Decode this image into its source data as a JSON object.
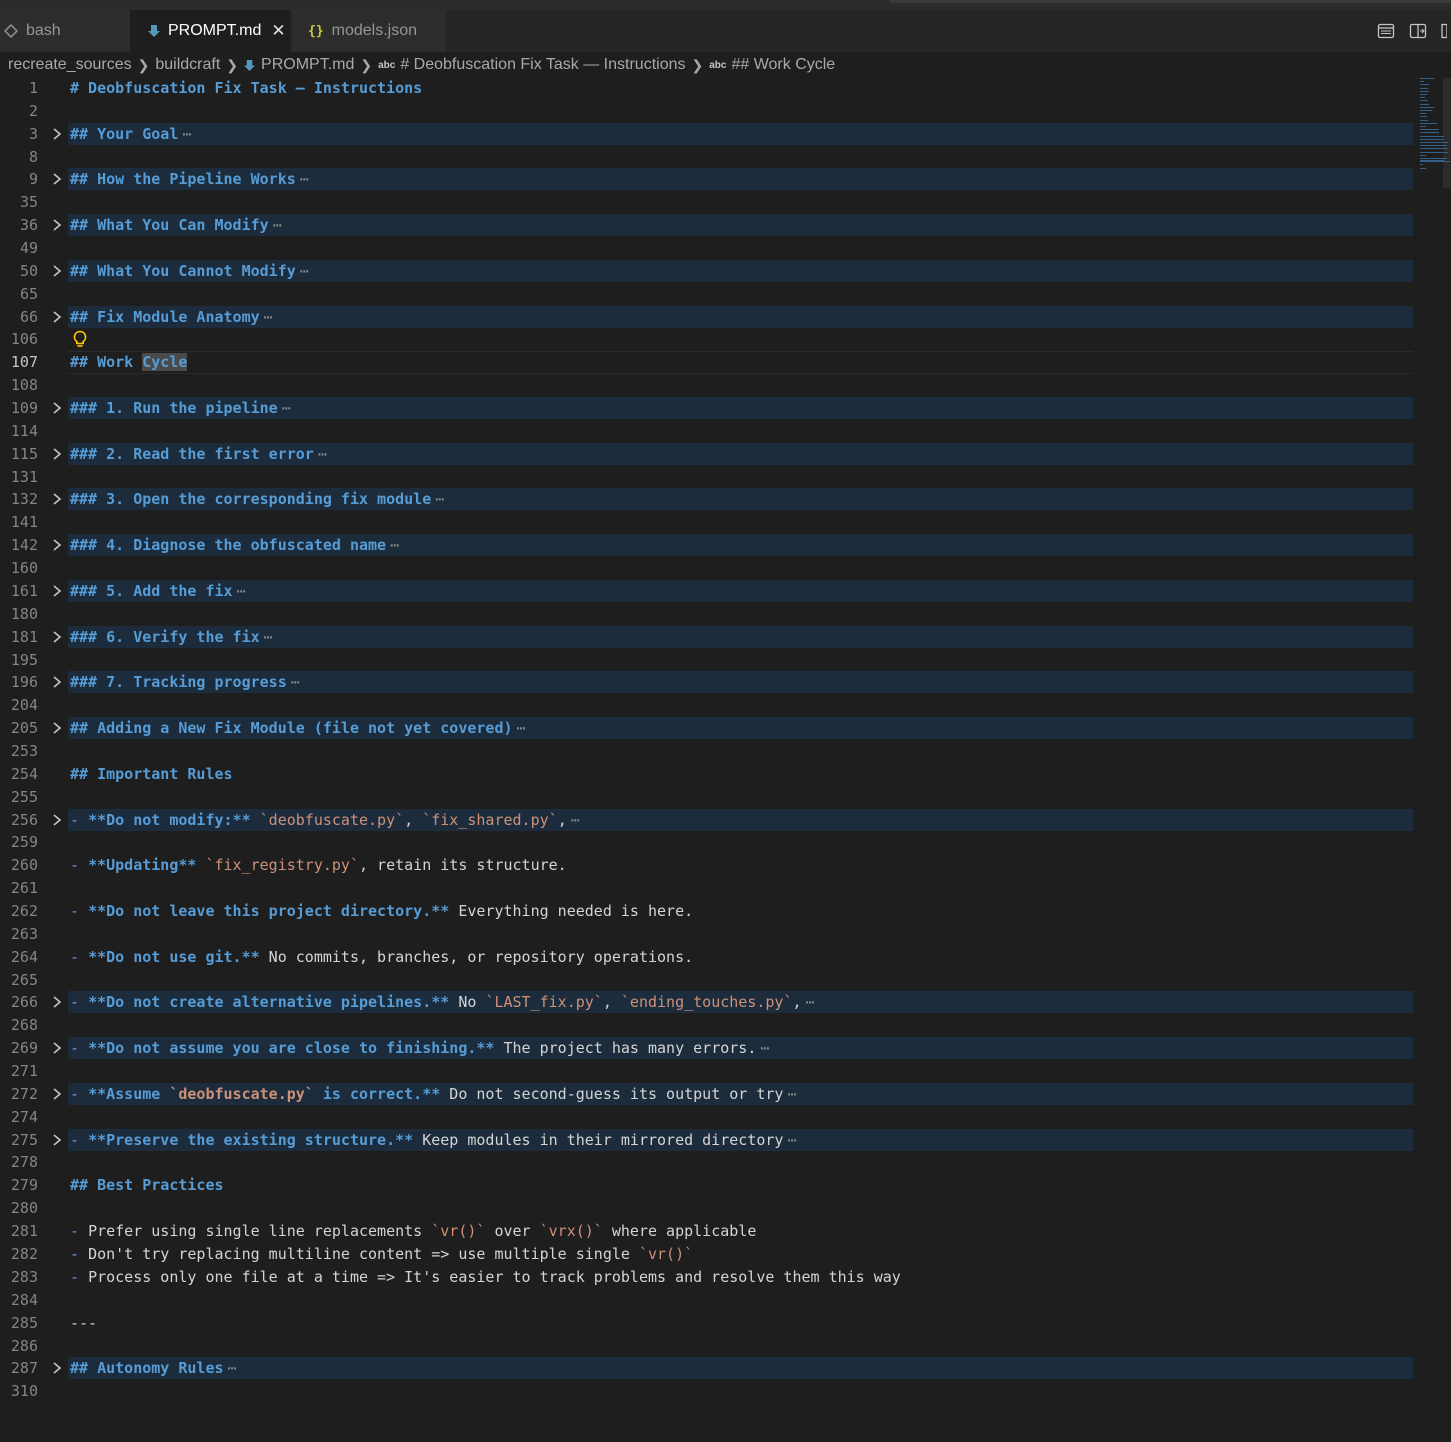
{
  "tabs": [
    {
      "label": "bash",
      "icon": "terminal-icon",
      "active": false
    },
    {
      "label": "PROMPT.md",
      "icon": "markdown-icon",
      "active": true
    },
    {
      "label": "models.json",
      "icon": "json-braces-icon",
      "active": false
    }
  ],
  "breadcrumb": {
    "folder1": "recreate_sources",
    "folder2": "buildcraft",
    "file": "PROMPT.md",
    "abc_badge": "abc",
    "section1": "# Deobfuscation Fix Task — Instructions",
    "section2": "## Work Cycle"
  },
  "editor": {
    "lines": [
      {
        "n": "1",
        "fold": false,
        "band": false,
        "segs": [
          {
            "t": "h",
            "v": "# Deobfuscation Fix Task — Instructions"
          }
        ]
      },
      {
        "n": "2",
        "segs": []
      },
      {
        "n": "3",
        "fold": true,
        "band": true,
        "segs": [
          {
            "t": "h",
            "v": "## Your Goal"
          }
        ]
      },
      {
        "n": "8",
        "segs": []
      },
      {
        "n": "9",
        "fold": true,
        "band": true,
        "segs": [
          {
            "t": "h",
            "v": "## How the Pipeline Works"
          }
        ]
      },
      {
        "n": "35",
        "segs": []
      },
      {
        "n": "36",
        "fold": true,
        "band": true,
        "segs": [
          {
            "t": "h",
            "v": "## What You Can Modify"
          }
        ]
      },
      {
        "n": "49",
        "segs": []
      },
      {
        "n": "50",
        "fold": true,
        "band": true,
        "segs": [
          {
            "t": "h",
            "v": "## What You Cannot Modify"
          }
        ]
      },
      {
        "n": "65",
        "segs": []
      },
      {
        "n": "66",
        "fold": true,
        "band": true,
        "segs": [
          {
            "t": "h",
            "v": "## Fix Module Anatomy"
          }
        ]
      },
      {
        "n": "106",
        "bulb": true,
        "segs": []
      },
      {
        "n": "107",
        "current": true,
        "segs": [
          {
            "t": "h",
            "v": "## Work "
          },
          {
            "t": "hhl",
            "v": "Cycle"
          }
        ]
      },
      {
        "n": "108",
        "segs": []
      },
      {
        "n": "109",
        "fold": true,
        "band": true,
        "segs": [
          {
            "t": "h",
            "v": "### 1. Run the pipeline"
          }
        ]
      },
      {
        "n": "114",
        "segs": []
      },
      {
        "n": "115",
        "fold": true,
        "band": true,
        "segs": [
          {
            "t": "h",
            "v": "### 2. Read the first error"
          }
        ]
      },
      {
        "n": "131",
        "segs": []
      },
      {
        "n": "132",
        "fold": true,
        "band": true,
        "segs": [
          {
            "t": "h",
            "v": "### 3. Open the corresponding fix module"
          }
        ]
      },
      {
        "n": "141",
        "segs": []
      },
      {
        "n": "142",
        "fold": true,
        "band": true,
        "segs": [
          {
            "t": "h",
            "v": "### 4. Diagnose the obfuscated name"
          }
        ]
      },
      {
        "n": "160",
        "segs": []
      },
      {
        "n": "161",
        "fold": true,
        "band": true,
        "segs": [
          {
            "t": "h",
            "v": "### 5. Add the fix"
          }
        ]
      },
      {
        "n": "180",
        "segs": []
      },
      {
        "n": "181",
        "fold": true,
        "band": true,
        "segs": [
          {
            "t": "h",
            "v": "### 6. Verify the fix"
          }
        ]
      },
      {
        "n": "195",
        "segs": []
      },
      {
        "n": "196",
        "fold": true,
        "band": true,
        "segs": [
          {
            "t": "h",
            "v": "### 7. Tracking progress"
          }
        ]
      },
      {
        "n": "204",
        "segs": []
      },
      {
        "n": "205",
        "fold": true,
        "band": true,
        "segs": [
          {
            "t": "h",
            "v": "## Adding a New Fix Module (file not yet covered)"
          }
        ]
      },
      {
        "n": "253",
        "segs": []
      },
      {
        "n": "254",
        "segs": [
          {
            "t": "h",
            "v": "## Important Rules"
          }
        ]
      },
      {
        "n": "255",
        "segs": []
      },
      {
        "n": "256",
        "fold": true,
        "band": true,
        "segs": [
          {
            "t": "dash",
            "v": "- "
          },
          {
            "t": "b",
            "v": "**Do not modify:**"
          },
          {
            "t": "p",
            "v": " "
          },
          {
            "t": "c",
            "v": "`deobfuscate.py`"
          },
          {
            "t": "p",
            "v": ", "
          },
          {
            "t": "c",
            "v": "`fix_shared.py`"
          },
          {
            "t": "p",
            "v": ","
          }
        ]
      },
      {
        "n": "259",
        "segs": []
      },
      {
        "n": "260",
        "segs": [
          {
            "t": "dash",
            "v": "- "
          },
          {
            "t": "b",
            "v": "**Updating**"
          },
          {
            "t": "p",
            "v": " "
          },
          {
            "t": "c",
            "v": "`fix_registry.py`"
          },
          {
            "t": "p",
            "v": ", retain its structure."
          }
        ]
      },
      {
        "n": "261",
        "segs": []
      },
      {
        "n": "262",
        "segs": [
          {
            "t": "dash",
            "v": "- "
          },
          {
            "t": "b",
            "v": "**Do not leave this project directory.**"
          },
          {
            "t": "p",
            "v": " Everything needed is here."
          }
        ]
      },
      {
        "n": "263",
        "segs": []
      },
      {
        "n": "264",
        "segs": [
          {
            "t": "dash",
            "v": "- "
          },
          {
            "t": "b",
            "v": "**Do not use git.**"
          },
          {
            "t": "p",
            "v": " No commits, branches, or repository operations."
          }
        ]
      },
      {
        "n": "265",
        "segs": []
      },
      {
        "n": "266",
        "fold": true,
        "band": true,
        "segs": [
          {
            "t": "dash",
            "v": "- "
          },
          {
            "t": "b",
            "v": "**Do not create alternative pipelines.**"
          },
          {
            "t": "p",
            "v": " No "
          },
          {
            "t": "c",
            "v": "`LAST_fix.py`"
          },
          {
            "t": "p",
            "v": ", "
          },
          {
            "t": "c",
            "v": "`ending_touches.py`"
          },
          {
            "t": "p",
            "v": ","
          }
        ]
      },
      {
        "n": "268",
        "segs": []
      },
      {
        "n": "269",
        "fold": true,
        "band": true,
        "segs": [
          {
            "t": "dash",
            "v": "- "
          },
          {
            "t": "b",
            "v": "**Do not assume you are close to finishing.**"
          },
          {
            "t": "p",
            "v": " The project has many errors."
          }
        ]
      },
      {
        "n": "271",
        "segs": []
      },
      {
        "n": "272",
        "fold": true,
        "band": true,
        "segs": [
          {
            "t": "dash",
            "v": "- "
          },
          {
            "t": "b",
            "v": "**Assume "
          },
          {
            "t": "cb",
            "v": "`deobfuscate.py`"
          },
          {
            "t": "b",
            "v": " is correct.**"
          },
          {
            "t": "p",
            "v": " Do not second-guess its output or try"
          }
        ]
      },
      {
        "n": "274",
        "segs": []
      },
      {
        "n": "275",
        "fold": true,
        "band": true,
        "segs": [
          {
            "t": "dash",
            "v": "- "
          },
          {
            "t": "b",
            "v": "**Preserve the existing structure.**"
          },
          {
            "t": "p",
            "v": " Keep modules in their mirrored directory"
          }
        ]
      },
      {
        "n": "278",
        "segs": []
      },
      {
        "n": "279",
        "segs": [
          {
            "t": "h",
            "v": "## Best Practices"
          }
        ]
      },
      {
        "n": "280",
        "segs": []
      },
      {
        "n": "281",
        "tight": true,
        "segs": [
          {
            "t": "dash",
            "v": "- "
          },
          {
            "t": "p",
            "v": "Prefer using single line replacements "
          },
          {
            "t": "c",
            "v": "`vr()`"
          },
          {
            "t": "p",
            "v": " over "
          },
          {
            "t": "c",
            "v": "`vrx()`"
          },
          {
            "t": "p",
            "v": " where applicable"
          }
        ]
      },
      {
        "n": "282",
        "tight": true,
        "segs": [
          {
            "t": "dash",
            "v": "- "
          },
          {
            "t": "p",
            "v": "Don't try replacing multiline content => use multiple single "
          },
          {
            "t": "c",
            "v": "`vr()`"
          }
        ]
      },
      {
        "n": "283",
        "tight": true,
        "segs": [
          {
            "t": "dash",
            "v": "- "
          },
          {
            "t": "p",
            "v": "Process only one file at a time => It's easier to track problems and resolve them this way"
          }
        ]
      },
      {
        "n": "284",
        "segs": []
      },
      {
        "n": "285",
        "segs": [
          {
            "t": "p",
            "v": "---"
          }
        ]
      },
      {
        "n": "286",
        "segs": []
      },
      {
        "n": "287",
        "fold": true,
        "band": true,
        "segs": [
          {
            "t": "h",
            "v": "## Autonomy Rules"
          }
        ]
      },
      {
        "n": "310",
        "segs": []
      }
    ]
  }
}
